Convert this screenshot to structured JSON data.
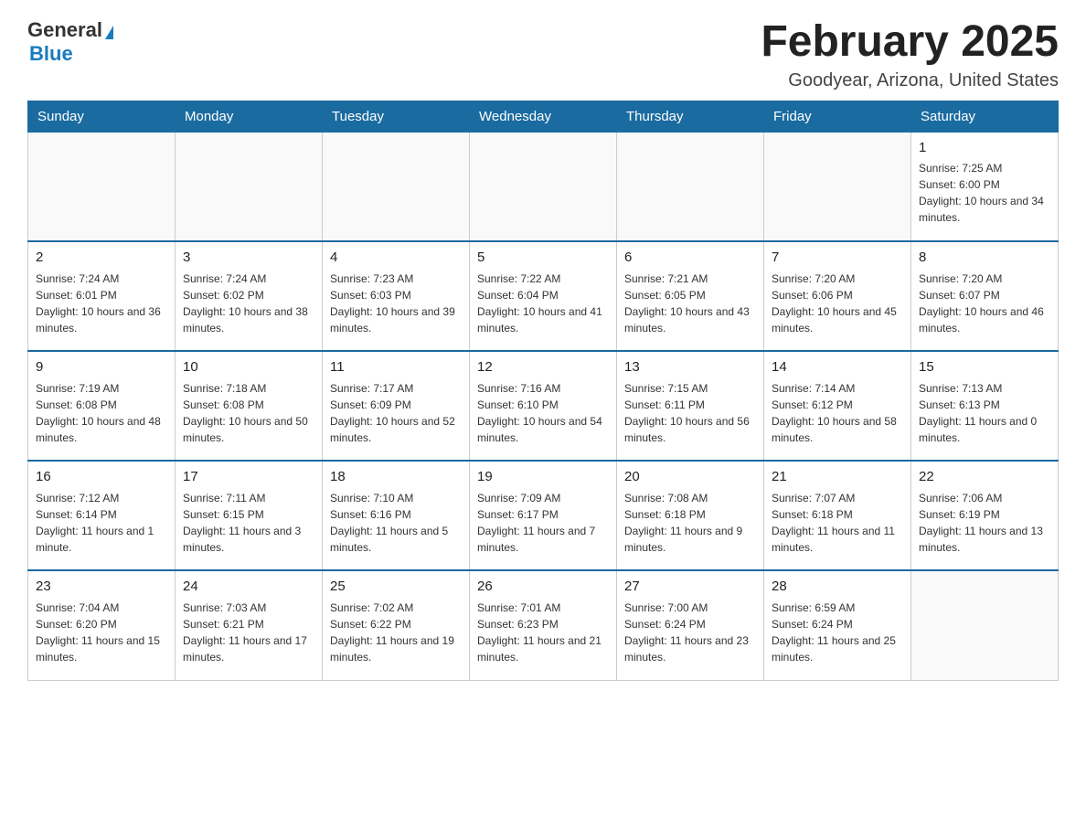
{
  "header": {
    "logo_general": "General",
    "logo_blue": "Blue",
    "month_title": "February 2025",
    "location": "Goodyear, Arizona, United States"
  },
  "days_of_week": [
    "Sunday",
    "Monday",
    "Tuesday",
    "Wednesday",
    "Thursday",
    "Friday",
    "Saturday"
  ],
  "weeks": [
    {
      "days": [
        {
          "num": "",
          "sunrise": "",
          "sunset": "",
          "daylight": ""
        },
        {
          "num": "",
          "sunrise": "",
          "sunset": "",
          "daylight": ""
        },
        {
          "num": "",
          "sunrise": "",
          "sunset": "",
          "daylight": ""
        },
        {
          "num": "",
          "sunrise": "",
          "sunset": "",
          "daylight": ""
        },
        {
          "num": "",
          "sunrise": "",
          "sunset": "",
          "daylight": ""
        },
        {
          "num": "",
          "sunrise": "",
          "sunset": "",
          "daylight": ""
        },
        {
          "num": "1",
          "sunrise": "Sunrise: 7:25 AM",
          "sunset": "Sunset: 6:00 PM",
          "daylight": "Daylight: 10 hours and 34 minutes."
        }
      ]
    },
    {
      "days": [
        {
          "num": "2",
          "sunrise": "Sunrise: 7:24 AM",
          "sunset": "Sunset: 6:01 PM",
          "daylight": "Daylight: 10 hours and 36 minutes."
        },
        {
          "num": "3",
          "sunrise": "Sunrise: 7:24 AM",
          "sunset": "Sunset: 6:02 PM",
          "daylight": "Daylight: 10 hours and 38 minutes."
        },
        {
          "num": "4",
          "sunrise": "Sunrise: 7:23 AM",
          "sunset": "Sunset: 6:03 PM",
          "daylight": "Daylight: 10 hours and 39 minutes."
        },
        {
          "num": "5",
          "sunrise": "Sunrise: 7:22 AM",
          "sunset": "Sunset: 6:04 PM",
          "daylight": "Daylight: 10 hours and 41 minutes."
        },
        {
          "num": "6",
          "sunrise": "Sunrise: 7:21 AM",
          "sunset": "Sunset: 6:05 PM",
          "daylight": "Daylight: 10 hours and 43 minutes."
        },
        {
          "num": "7",
          "sunrise": "Sunrise: 7:20 AM",
          "sunset": "Sunset: 6:06 PM",
          "daylight": "Daylight: 10 hours and 45 minutes."
        },
        {
          "num": "8",
          "sunrise": "Sunrise: 7:20 AM",
          "sunset": "Sunset: 6:07 PM",
          "daylight": "Daylight: 10 hours and 46 minutes."
        }
      ]
    },
    {
      "days": [
        {
          "num": "9",
          "sunrise": "Sunrise: 7:19 AM",
          "sunset": "Sunset: 6:08 PM",
          "daylight": "Daylight: 10 hours and 48 minutes."
        },
        {
          "num": "10",
          "sunrise": "Sunrise: 7:18 AM",
          "sunset": "Sunset: 6:08 PM",
          "daylight": "Daylight: 10 hours and 50 minutes."
        },
        {
          "num": "11",
          "sunrise": "Sunrise: 7:17 AM",
          "sunset": "Sunset: 6:09 PM",
          "daylight": "Daylight: 10 hours and 52 minutes."
        },
        {
          "num": "12",
          "sunrise": "Sunrise: 7:16 AM",
          "sunset": "Sunset: 6:10 PM",
          "daylight": "Daylight: 10 hours and 54 minutes."
        },
        {
          "num": "13",
          "sunrise": "Sunrise: 7:15 AM",
          "sunset": "Sunset: 6:11 PM",
          "daylight": "Daylight: 10 hours and 56 minutes."
        },
        {
          "num": "14",
          "sunrise": "Sunrise: 7:14 AM",
          "sunset": "Sunset: 6:12 PM",
          "daylight": "Daylight: 10 hours and 58 minutes."
        },
        {
          "num": "15",
          "sunrise": "Sunrise: 7:13 AM",
          "sunset": "Sunset: 6:13 PM",
          "daylight": "Daylight: 11 hours and 0 minutes."
        }
      ]
    },
    {
      "days": [
        {
          "num": "16",
          "sunrise": "Sunrise: 7:12 AM",
          "sunset": "Sunset: 6:14 PM",
          "daylight": "Daylight: 11 hours and 1 minute."
        },
        {
          "num": "17",
          "sunrise": "Sunrise: 7:11 AM",
          "sunset": "Sunset: 6:15 PM",
          "daylight": "Daylight: 11 hours and 3 minutes."
        },
        {
          "num": "18",
          "sunrise": "Sunrise: 7:10 AM",
          "sunset": "Sunset: 6:16 PM",
          "daylight": "Daylight: 11 hours and 5 minutes."
        },
        {
          "num": "19",
          "sunrise": "Sunrise: 7:09 AM",
          "sunset": "Sunset: 6:17 PM",
          "daylight": "Daylight: 11 hours and 7 minutes."
        },
        {
          "num": "20",
          "sunrise": "Sunrise: 7:08 AM",
          "sunset": "Sunset: 6:18 PM",
          "daylight": "Daylight: 11 hours and 9 minutes."
        },
        {
          "num": "21",
          "sunrise": "Sunrise: 7:07 AM",
          "sunset": "Sunset: 6:18 PM",
          "daylight": "Daylight: 11 hours and 11 minutes."
        },
        {
          "num": "22",
          "sunrise": "Sunrise: 7:06 AM",
          "sunset": "Sunset: 6:19 PM",
          "daylight": "Daylight: 11 hours and 13 minutes."
        }
      ]
    },
    {
      "days": [
        {
          "num": "23",
          "sunrise": "Sunrise: 7:04 AM",
          "sunset": "Sunset: 6:20 PM",
          "daylight": "Daylight: 11 hours and 15 minutes."
        },
        {
          "num": "24",
          "sunrise": "Sunrise: 7:03 AM",
          "sunset": "Sunset: 6:21 PM",
          "daylight": "Daylight: 11 hours and 17 minutes."
        },
        {
          "num": "25",
          "sunrise": "Sunrise: 7:02 AM",
          "sunset": "Sunset: 6:22 PM",
          "daylight": "Daylight: 11 hours and 19 minutes."
        },
        {
          "num": "26",
          "sunrise": "Sunrise: 7:01 AM",
          "sunset": "Sunset: 6:23 PM",
          "daylight": "Daylight: 11 hours and 21 minutes."
        },
        {
          "num": "27",
          "sunrise": "Sunrise: 7:00 AM",
          "sunset": "Sunset: 6:24 PM",
          "daylight": "Daylight: 11 hours and 23 minutes."
        },
        {
          "num": "28",
          "sunrise": "Sunrise: 6:59 AM",
          "sunset": "Sunset: 6:24 PM",
          "daylight": "Daylight: 11 hours and 25 minutes."
        },
        {
          "num": "",
          "sunrise": "",
          "sunset": "",
          "daylight": ""
        }
      ]
    }
  ]
}
